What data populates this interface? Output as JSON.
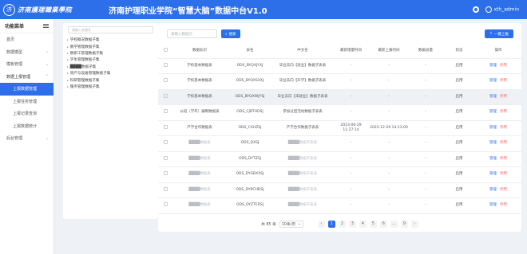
{
  "header": {
    "logo_glyph": "济",
    "logo_text": "济南護理職業學院",
    "title": "济南护理职业学院“智慧大脑”数据中台V1.0",
    "user": "xth_admin"
  },
  "sidebar": {
    "title": "功能菜单",
    "items": [
      {
        "label": "首页"
      },
      {
        "label": "数据模型"
      },
      {
        "label": "模板管理"
      },
      {
        "label": "数据上报管理"
      }
    ],
    "subitems": [
      {
        "label": "上报数据管理"
      },
      {
        "label": "上报任务管理"
      },
      {
        "label": "上报记录查询"
      },
      {
        "label": "上报数据统计"
      }
    ],
    "last": {
      "label": "后台管理"
    }
  },
  "tree": {
    "placeholder": "请输入关键字",
    "items": [
      "学校概况数据子集",
      "教学管理数据子集",
      "教职工管理数据子集",
      "学生管理数据子集",
      "████数据子集",
      "资产与设备管理数据子集",
      "科研管理数据子集",
      "服务管理数据子集"
    ]
  },
  "toolbar": {
    "search_placeholder": "请输入数据元",
    "search_label": "搜索",
    "upload_label": "一键上报"
  },
  "table": {
    "columns": [
      "",
      "数据标识",
      "表名",
      "中文名",
      "最新增量时间",
      "最新上报时间",
      "数据总量",
      "状态",
      "操作"
    ],
    "rows": [
      {
        "id": "学校基本数据表",
        "table": "ODS_BYQXJYXJ",
        "cn": "毕业去向【就业】数据子表表",
        "inc": "-",
        "rep": "-",
        "total": "-",
        "status": "启用",
        "blur": false,
        "hl": false
      },
      {
        "id": "学校基本数据表",
        "table": "ODS_BYQXSXXJ",
        "cn": "毕业去向【升学】数据子表表",
        "inc": "-",
        "rep": "-",
        "total": "-",
        "status": "启用",
        "blur": false,
        "hl": false
      },
      {
        "id": "学校基本数据表",
        "table": "ODS_BYQXWJYSJ",
        "cn": "毕业去向【未就业】数据子表表",
        "inc": "-",
        "rep": "-",
        "total": "-",
        "status": "启用",
        "blur": false,
        "hl": true
      },
      {
        "id": "以班（学年）编制数据表",
        "table": "ODS_CJBTHDSJ",
        "cn": "参加过团活动数据子表表",
        "inc": "-",
        "rep": "-",
        "total": "-",
        "status": "启用",
        "blur": false,
        "hl": false
      },
      {
        "id": "产学合作数据表",
        "table": "ODS_CXHZSJ",
        "cn": "产学合作数据子表表",
        "inc": "2023-06-29 11:27:14",
        "rep": "2023-12-29 14:13:00",
        "total": "-",
        "status": "启用",
        "blur": false,
        "hl": false
      },
      {
        "id": "████数据表",
        "table": "ODS_DXSJ",
        "cn": "████数据子表表",
        "inc": "-",
        "rep": "-",
        "total": "-",
        "status": "启用",
        "blur": true,
        "hl": false
      },
      {
        "id": "████数据表",
        "table": "ODS_DYTZSJ",
        "cn": "████数据子表表",
        "inc": "-",
        "rep": "-",
        "total": "-",
        "status": "启用",
        "blur": true,
        "hl": false
      },
      {
        "id": "████数据表",
        "table": "ODS_DYGBXXSJ",
        "cn": "████数据子表表",
        "inc": "-",
        "rep": "-",
        "total": "-",
        "status": "启用",
        "blur": true,
        "hl": false
      },
      {
        "id": "████数据表",
        "table": "ODS_DYRCHDSJ",
        "cn": "████数据子表表",
        "inc": "-",
        "rep": "-",
        "total": "-",
        "status": "启用",
        "blur": true,
        "hl": false
      },
      {
        "id": "████数据表",
        "table": "ODS_DYZTERSJ",
        "cn": "████数据子表表",
        "inc": "-",
        "rep": "-",
        "total": "-",
        "status": "启用",
        "blur": true,
        "hl": false
      }
    ],
    "action_manage": "管理",
    "action_disable": "停用"
  },
  "pager": {
    "total": "共 85 条",
    "size": "10条/页",
    "prev": "‹",
    "next": "›",
    "pages": [
      "1",
      "2",
      "3",
      "4",
      "5",
      "6",
      "...",
      "9"
    ],
    "active": "1"
  },
  "colors": {
    "primary": "#2d6fe8",
    "danger": "#f56c6c"
  }
}
